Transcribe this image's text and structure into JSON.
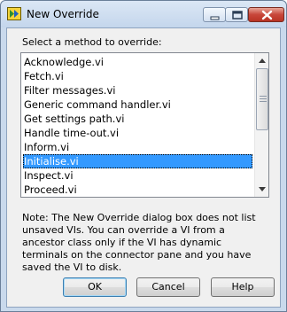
{
  "window": {
    "title": "New Override"
  },
  "dialog": {
    "prompt": "Select a method to override:",
    "methods": [
      "Acknowledge.vi",
      "Fetch.vi",
      "Filter messages.vi",
      "Generic command handler.vi",
      "Get settings path.vi",
      "Handle time-out.vi",
      "Inform.vi",
      "Initialise.vi",
      "Inspect.vi",
      "Proceed.vi"
    ],
    "selected_method": "Initialise.vi",
    "note": "Note: The New Override dialog box does not list unsaved VIs. You can override a VI from a ancestor class only if the VI has dynamic terminals on the connector pane and you have saved the VI to disk.",
    "buttons": {
      "ok": "OK",
      "cancel": "Cancel",
      "help": "Help"
    }
  },
  "colors": {
    "selection": "#3399ff",
    "titlebar": "#c9d9ec",
    "close_button": "#c8463a"
  }
}
